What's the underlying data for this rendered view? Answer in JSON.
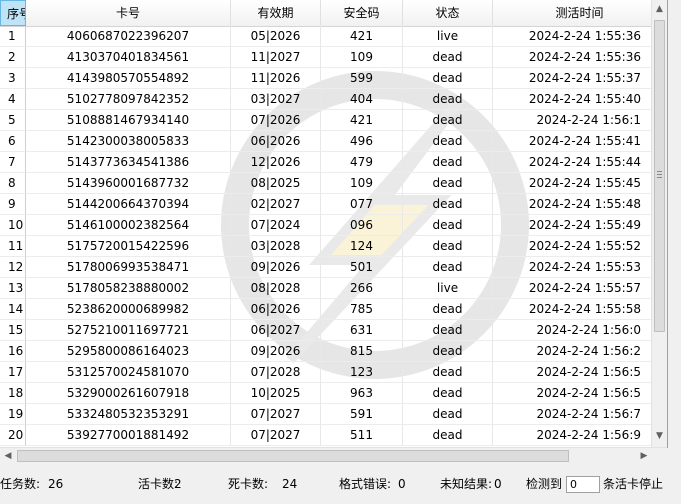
{
  "table": {
    "headers": [
      "序号",
      "卡号",
      "有效期",
      "安全码",
      "状态",
      "测活时间"
    ],
    "rows": [
      [
        "1",
        "4060687022396207",
        "05|2026",
        "421",
        "live",
        "2024-2-24 1:55:36"
      ],
      [
        "2",
        "4130370401834561",
        "11|2027",
        "109",
        "dead",
        "2024-2-24 1:55:36"
      ],
      [
        "3",
        "4143980570554892",
        "11|2026",
        "599",
        "dead",
        "2024-2-24 1:55:37"
      ],
      [
        "4",
        "5102778097842352",
        "03|2027",
        "404",
        "dead",
        "2024-2-24 1:55:40"
      ],
      [
        "5",
        "5108881467934140",
        "07|2026",
        "421",
        "dead",
        "2024-2-24 1:56:1"
      ],
      [
        "6",
        "5142300038005833",
        "06|2026",
        "496",
        "dead",
        "2024-2-24 1:55:41"
      ],
      [
        "7",
        "5143773634541386",
        "12|2026",
        "479",
        "dead",
        "2024-2-24 1:55:44"
      ],
      [
        "8",
        "5143960001687732",
        "08|2025",
        "109",
        "dead",
        "2024-2-24 1:55:45"
      ],
      [
        "9",
        "5144200664370394",
        "02|2027",
        "077",
        "dead",
        "2024-2-24 1:55:48"
      ],
      [
        "10",
        "5146100002382564",
        "07|2024",
        "096",
        "dead",
        "2024-2-24 1:55:49"
      ],
      [
        "11",
        "5175720015422596",
        "03|2028",
        "124",
        "dead",
        "2024-2-24 1:55:52"
      ],
      [
        "12",
        "5178006993538471",
        "09|2026",
        "501",
        "dead",
        "2024-2-24 1:55:53"
      ],
      [
        "13",
        "5178058238880002",
        "08|2028",
        "266",
        "live",
        "2024-2-24 1:55:57"
      ],
      [
        "14",
        "5238620000689982",
        "06|2026",
        "785",
        "dead",
        "2024-2-24 1:55:58"
      ],
      [
        "15",
        "5275210011697721",
        "06|2027",
        "631",
        "dead",
        "2024-2-24 1:56:0"
      ],
      [
        "16",
        "5295800086164023",
        "09|2026",
        "815",
        "dead",
        "2024-2-24 1:56:2"
      ],
      [
        "17",
        "5312570024581070",
        "07|2028",
        "123",
        "dead",
        "2024-2-24 1:56:5"
      ],
      [
        "18",
        "5329000261607918",
        "10|2025",
        "963",
        "dead",
        "2024-2-24 1:56:5"
      ],
      [
        "19",
        "5332480532353291",
        "07|2027",
        "591",
        "dead",
        "2024-2-24 1:56:7"
      ],
      [
        "20",
        "5392770001881492",
        "07|2027",
        "511",
        "dead",
        "2024-2-24 1:56:9"
      ]
    ]
  },
  "status": {
    "tasks_label": "任务数:",
    "tasks_value": "26",
    "live_label": "活卡数:",
    "live_value": "2",
    "dead_label": "死卡数:",
    "dead_value": "24",
    "format_error_label": "格式错误:",
    "format_error_value": "0",
    "unknown_label": "未知结果:",
    "unknown_value": "0",
    "detect_label": "检测到",
    "stop_input_value": "0",
    "stop_suffix": "条活卡停止"
  },
  "colors": {
    "header_selected": "#bfe3f7",
    "watermark": "#d8d8d8",
    "watermark_accent": "#f6e9b2"
  }
}
